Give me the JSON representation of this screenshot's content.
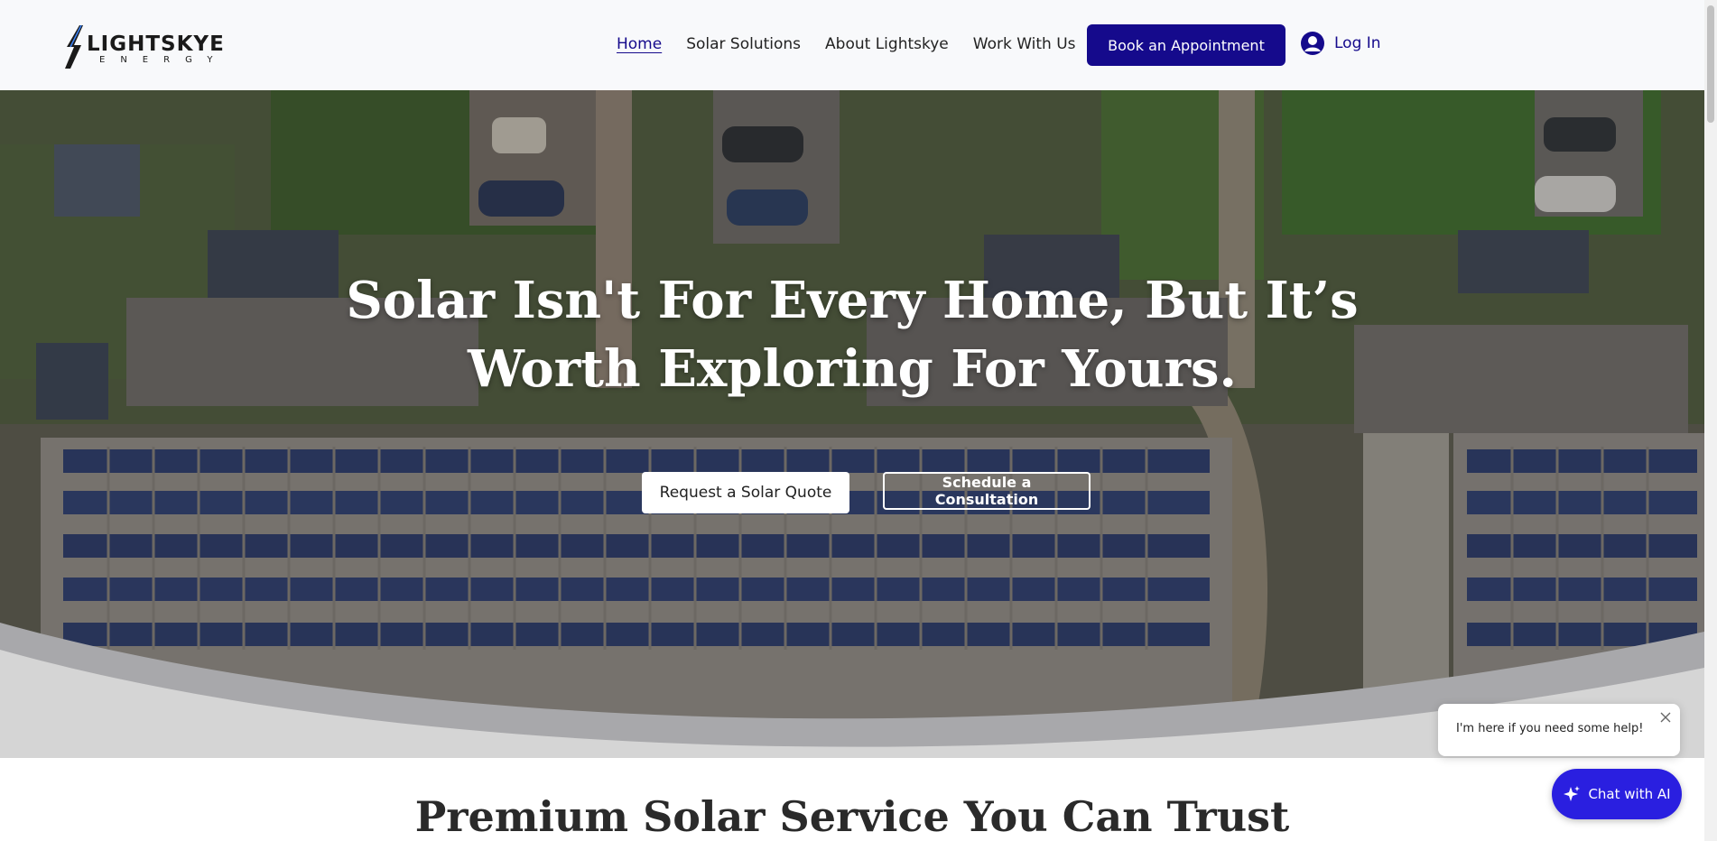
{
  "brand": {
    "name": "LIGHTSKYE",
    "subtitle": "ENERGY",
    "accent_color": "#150a8c"
  },
  "nav": {
    "items": [
      {
        "label": "Home"
      },
      {
        "label": "Solar Solutions"
      },
      {
        "label": "About Lightskye"
      },
      {
        "label": "Work With Us"
      }
    ],
    "book_label": "Book an Appointment",
    "login_label": "Log In"
  },
  "hero": {
    "title_line1": "Solar Isn't For Every Home, But It’s",
    "title_line2": "Worth Exploring For Yours.",
    "quote_button": "Request a Solar Quote",
    "consult_button": "Schedule a Consultation"
  },
  "section": {
    "title": "Premium Solar Service You Can Trust"
  },
  "chat": {
    "bubble_text": "I'm here if you need some help!",
    "button_label": "Chat with AI",
    "button_color": "#2a1fe0"
  }
}
